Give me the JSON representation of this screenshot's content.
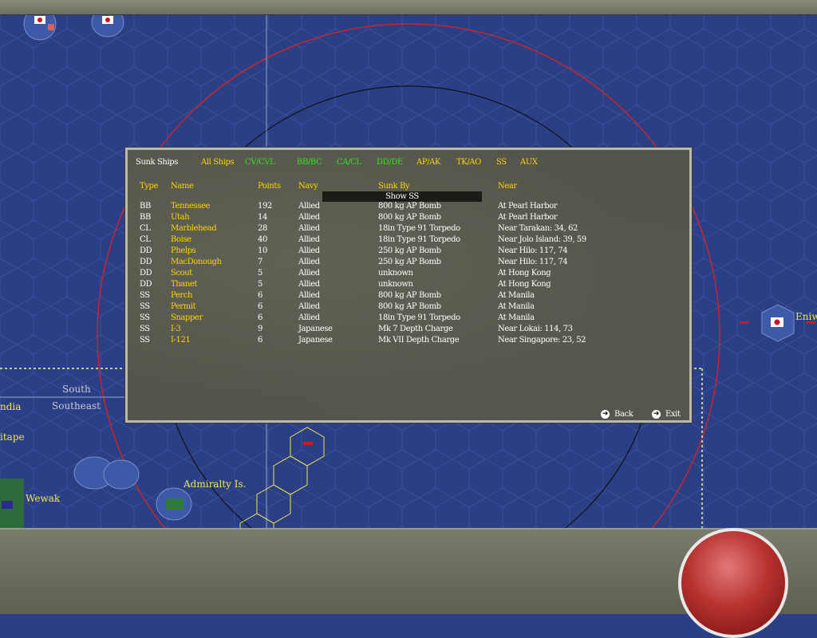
{
  "map": {
    "labels": {
      "south": "South",
      "southeast": "Southeast",
      "ndia": "ndia",
      "itape": "itape",
      "wewak": "Wewak",
      "admiralty": "Admiralty Is.",
      "eniw": "Eniw"
    }
  },
  "dialog": {
    "title": "Sunk Ships",
    "filters": [
      {
        "label": "All Ships",
        "color": "#ffd400"
      },
      {
        "label": "CV/CVL",
        "color": "#35e21b"
      },
      {
        "label": "BB/BC",
        "color": "#35e21b"
      },
      {
        "label": "CA/CL",
        "color": "#35e21b"
      },
      {
        "label": "DD/DE",
        "color": "#35e21b"
      },
      {
        "label": "AP/AK",
        "color": "#ffd400"
      },
      {
        "label": "TK/AO",
        "color": "#ffd400"
      },
      {
        "label": "SS",
        "color": "#ffd400"
      },
      {
        "label": "AUX",
        "color": "#ffd400"
      }
    ],
    "headers": {
      "type": "Type",
      "name": "Name",
      "points": "Points",
      "navy": "Navy",
      "sunk_by": "Sunk By",
      "near": "Near"
    },
    "tooltip": "Show SS",
    "rows": [
      {
        "type": "BB",
        "name": "Tennessee",
        "points": "192",
        "navy": "Allied",
        "sunk_by": "800 kg AP Bomb",
        "near": "At Pearl Harbor"
      },
      {
        "type": "BB",
        "name": "Utah",
        "points": "14",
        "navy": "Allied",
        "sunk_by": "800 kg AP Bomb",
        "near": "At Pearl Harbor"
      },
      {
        "type": "CL",
        "name": "Marblehead",
        "points": "28",
        "navy": "Allied",
        "sunk_by": "18in Type 91 Torpedo",
        "near": "Near Tarakan: 34, 62"
      },
      {
        "type": "CL",
        "name": "Boise",
        "points": "40",
        "navy": "Allied",
        "sunk_by": "18in Type 91 Torpedo",
        "near": "Near Jolo Island: 39, 59"
      },
      {
        "type": "DD",
        "name": "Phelps",
        "points": "10",
        "navy": "Allied",
        "sunk_by": "250 kg AP Bomb",
        "near": "Near Hilo: 117, 74"
      },
      {
        "type": "DD",
        "name": "MacDonough",
        "points": "7",
        "navy": "Allied",
        "sunk_by": "250 kg AP Bomb",
        "near": "Near Hilo: 117, 74"
      },
      {
        "type": "DD",
        "name": "Scout",
        "points": "5",
        "navy": "Allied",
        "sunk_by": "unknown",
        "near": "At Hong Kong"
      },
      {
        "type": "DD",
        "name": "Thanet",
        "points": "5",
        "navy": "Allied",
        "sunk_by": "unknown",
        "near": "At Hong Kong"
      },
      {
        "type": "SS",
        "name": "Perch",
        "points": "6",
        "navy": "Allied",
        "sunk_by": "800 kg AP Bomb",
        "near": "At Manila"
      },
      {
        "type": "SS",
        "name": "Permit",
        "points": "6",
        "navy": "Allied",
        "sunk_by": "800 kg AP Bomb",
        "near": "At Manila"
      },
      {
        "type": "SS",
        "name": "Snapper",
        "points": "6",
        "navy": "Allied",
        "sunk_by": "18in Type 91 Torpedo",
        "near": "At Manila"
      },
      {
        "type": "SS",
        "name": "I-3",
        "points": "9",
        "navy": "Japanese",
        "sunk_by": "Mk 7 Depth Charge",
        "near": "Near Lokai: 114, 73"
      },
      {
        "type": "SS",
        "name": "I-121",
        "points": "6",
        "navy": "Japanese",
        "sunk_by": "Mk VII Depth Charge",
        "near": "Near Singapore: 23, 52"
      }
    ],
    "buttons": {
      "back": "Back",
      "exit": "Exit"
    }
  }
}
